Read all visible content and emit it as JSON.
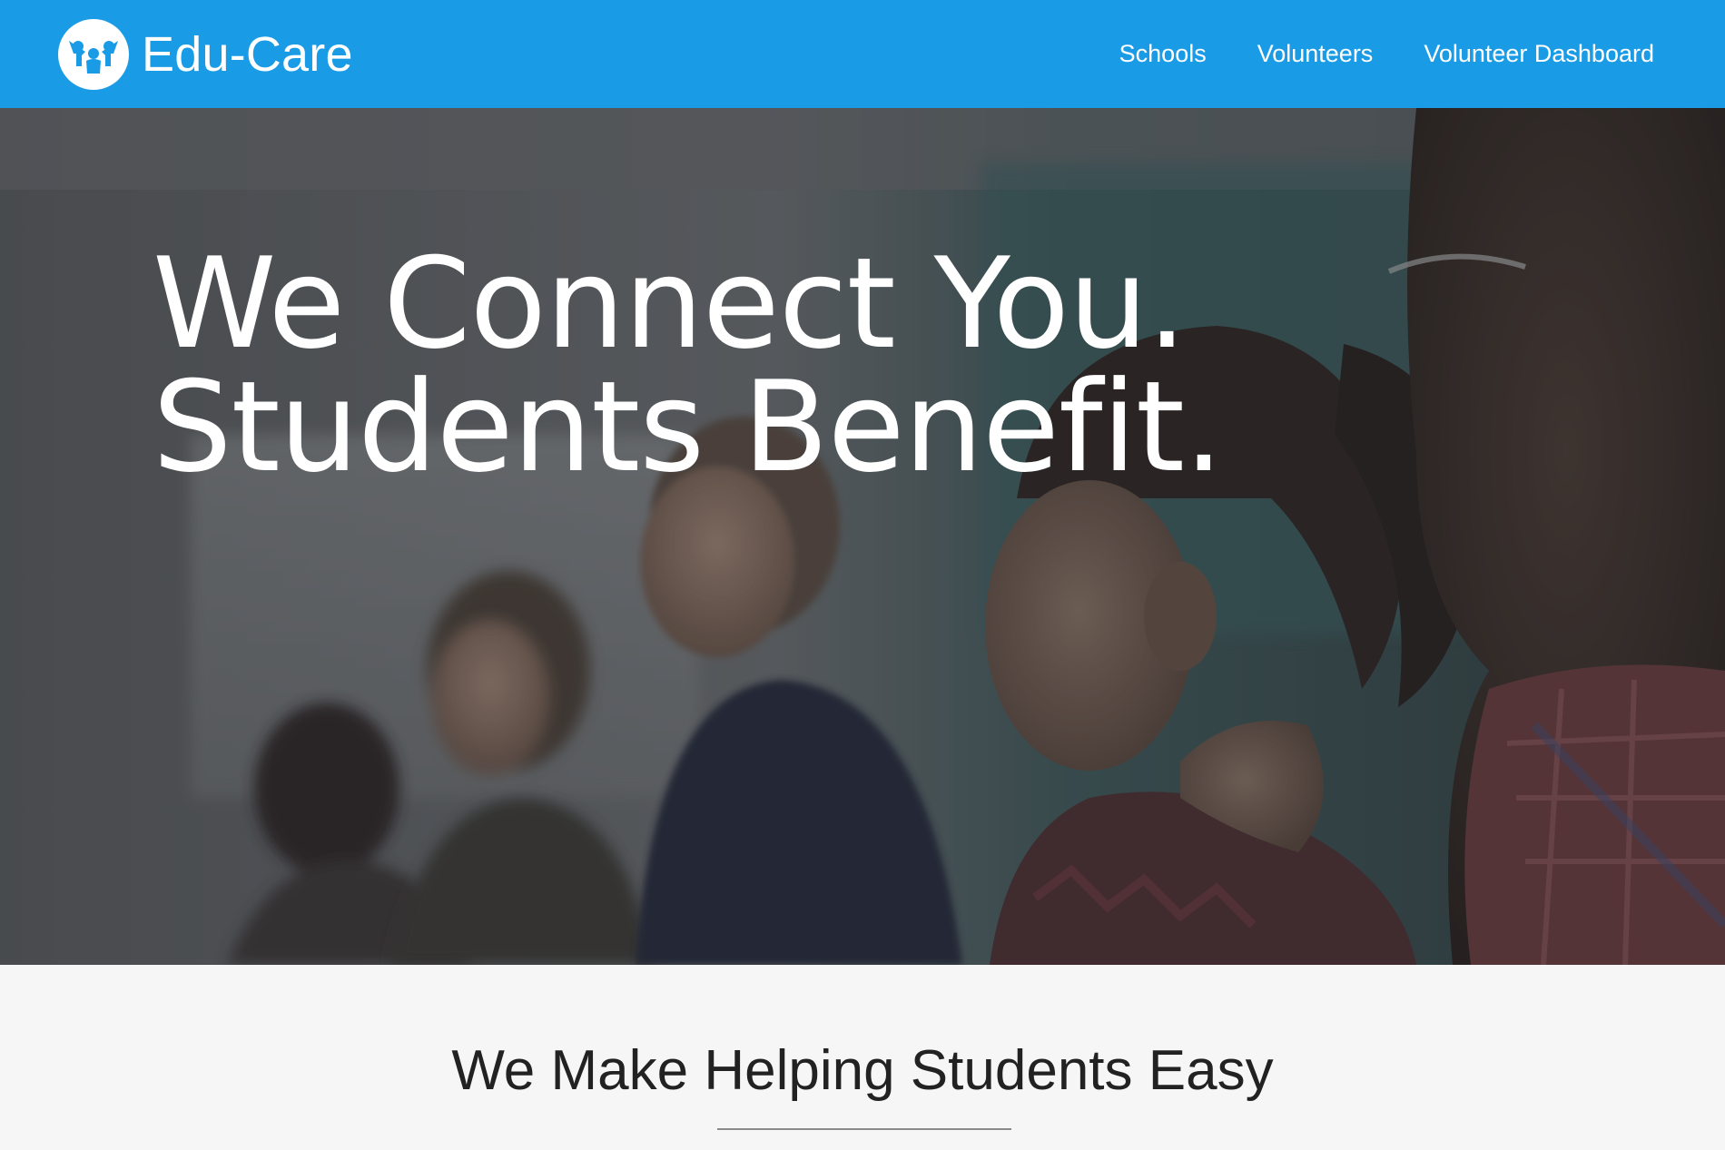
{
  "brand": {
    "name": "Edu-Care",
    "logo_icon": "people-group-icon",
    "color": "#1a9be6"
  },
  "nav": {
    "links": [
      {
        "label": "Schools"
      },
      {
        "label": "Volunteers"
      },
      {
        "label": "Volunteer Dashboard"
      }
    ]
  },
  "hero": {
    "line1": "We Connect You.",
    "line2": "Students Benefit.",
    "image": "classroom-students-photo"
  },
  "intro": {
    "heading": "We Make Helping Students Easy"
  }
}
